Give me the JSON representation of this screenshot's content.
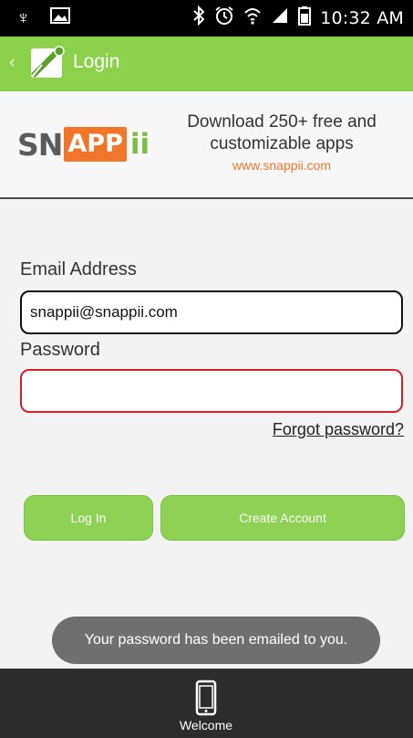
{
  "status_bar": {
    "time": "10:32 AM",
    "icons": [
      "usb-icon",
      "gallery-icon",
      "bluetooth-icon",
      "alarm-icon",
      "wifi-icon",
      "signal-icon",
      "battery-icon"
    ]
  },
  "action_bar": {
    "title": "Login",
    "back_icon": "chevron-left-icon",
    "app_icon": "app-icon",
    "color": "#8bd24a"
  },
  "banner": {
    "logo_text": "SNAPPii",
    "line1": "Download 250+ free and customizable apps",
    "url": "www.snappii.com",
    "url_color": "#f2762a"
  },
  "form": {
    "email_label": "Email Address",
    "email_value": "snappii@snappii.com",
    "password_label": "Password",
    "password_value": "",
    "forgot_link": "Forgot password?",
    "login_button": "Log In",
    "create_button": "Create Account",
    "button_color": "#8dd155"
  },
  "toast": {
    "message": "Your password has been emailed to you."
  },
  "tab_bar": {
    "tabs": [
      {
        "label": "Welcome",
        "icon": "phone-icon"
      }
    ]
  }
}
